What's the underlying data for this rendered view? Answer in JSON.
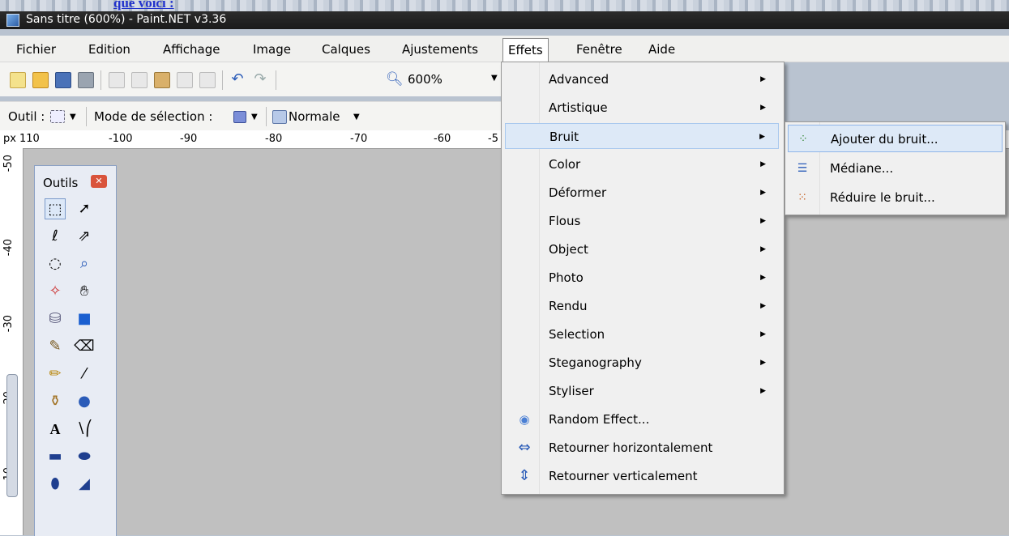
{
  "background_link": "que voici :",
  "window": {
    "title": "Sans titre (600%) - Paint.NET v3.36"
  },
  "menubar": {
    "items": [
      "Fichier",
      "Edition",
      "Affichage",
      "Image",
      "Calques",
      "Ajustements",
      "Effets",
      "Fenêtre",
      "Aide"
    ],
    "active": "Effets"
  },
  "toolbar": {
    "zoom": "600%"
  },
  "toolbar2": {
    "tool_label": "Outil :",
    "selection_mode_label": "Mode de sélection :",
    "blend_mode": "Normale"
  },
  "ruler": {
    "unit": "px",
    "h_labels": [
      "110",
      "-100",
      "-90",
      "-80",
      "-70",
      "-60",
      "-5"
    ],
    "v_labels": [
      "-50",
      "-40",
      "-30",
      "-20",
      "-10"
    ]
  },
  "tools_panel": {
    "title": "Outils"
  },
  "effets_menu": {
    "items": [
      {
        "label": "Advanced",
        "submenu": true
      },
      {
        "label": "Artistique",
        "submenu": true
      },
      {
        "label": "Bruit",
        "submenu": true,
        "highlighted": true
      },
      {
        "label": "Color",
        "submenu": true
      },
      {
        "label": "Déformer",
        "submenu": true
      },
      {
        "label": "Flous",
        "submenu": true
      },
      {
        "label": "Object",
        "submenu": true
      },
      {
        "label": "Photo",
        "submenu": true
      },
      {
        "label": "Rendu",
        "submenu": true
      },
      {
        "label": "Selection",
        "submenu": true
      },
      {
        "label": "Steganography",
        "submenu": true
      },
      {
        "label": "Styliser",
        "submenu": true
      },
      {
        "label": "Random Effect...",
        "icon": "random-effect-icon"
      },
      {
        "label": "Retourner horizontalement",
        "icon": "flip-horizontal-icon"
      },
      {
        "label": "Retourner verticalement",
        "icon": "flip-vertical-icon"
      }
    ]
  },
  "bruit_submenu": {
    "items": [
      {
        "label": "Ajouter du bruit...",
        "icon": "add-noise-icon",
        "highlighted": true
      },
      {
        "label": "Médiane...",
        "icon": "median-icon"
      },
      {
        "label": "Réduire le bruit...",
        "icon": "reduce-noise-icon"
      }
    ]
  },
  "colors": {
    "highlight": "#dde9f7",
    "canvas": "#c0c0c0",
    "titlebar": "#1a1a1a"
  }
}
